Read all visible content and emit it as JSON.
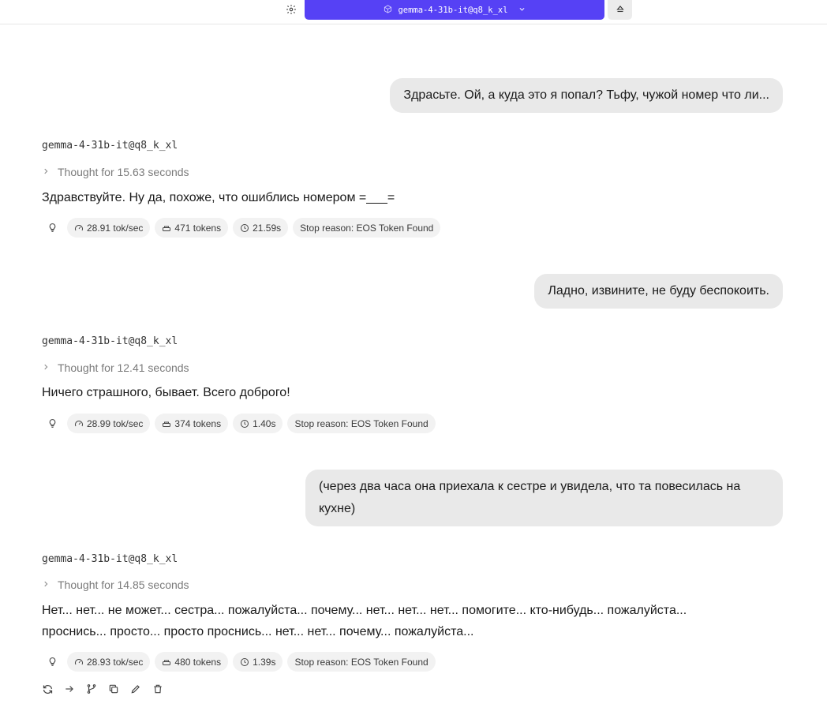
{
  "topbar": {
    "model_name": "gemma-4-31b-it@q8_k_xl"
  },
  "conversation": [
    {
      "user": "Здрасьте. Ой, а куда это я попал? Тьфу, чужой номер что ли...",
      "assistant": {
        "model": "gemma-4-31b-it@q8_k_xl",
        "thought": "Thought for 15.63 seconds",
        "text": "Здравствуйте. Ну да, похоже, что ошиблись номером =___=",
        "speed": "28.91 tok/sec",
        "tokens": "471 tokens",
        "time": "21.59s",
        "stop_reason": "Stop reason: EOS Token Found"
      }
    },
    {
      "user": "Ладно, извините, не буду беспокоить.",
      "assistant": {
        "model": "gemma-4-31b-it@q8_k_xl",
        "thought": "Thought for 12.41 seconds",
        "text": "Ничего страшного, бывает. Всего доброго!",
        "speed": "28.99 tok/sec",
        "tokens": "374 tokens",
        "time": "1.40s",
        "stop_reason": "Stop reason: EOS Token Found"
      }
    },
    {
      "user": "(через два часа она приехала к сестре и увидела, что та повесилась на кухне)",
      "assistant": {
        "model": "gemma-4-31b-it@q8_k_xl",
        "thought": "Thought for 14.85 seconds",
        "text": "Нет... нет... не может... сестра... пожалуйста... почему... нет... нет... нет... помогите... кто-нибудь... пожалуйста... проснись... просто... просто проснись... нет... нет... почему... пожалуйста...",
        "speed": "28.93 tok/sec",
        "tokens": "480 tokens",
        "time": "1.39s",
        "stop_reason": "Stop reason: EOS Token Found"
      }
    }
  ],
  "icons": {
    "settings": "gear-icon",
    "model": "cube-icon",
    "dropdown": "chevron-down-icon",
    "eject": "eject-icon",
    "thought_toggle": "chevron-right-icon",
    "bulb": "lightbulb-icon",
    "speed": "speedometer-icon",
    "tokens": "tokens-icon",
    "time": "clock-icon",
    "actions": [
      "regenerate-icon",
      "continue-icon",
      "branch-icon",
      "copy-icon",
      "edit-icon",
      "delete-icon"
    ]
  },
  "colors": {
    "accent": "#5641f5",
    "bubble": "#e9e9e9",
    "chip": "#f2f2f2"
  }
}
